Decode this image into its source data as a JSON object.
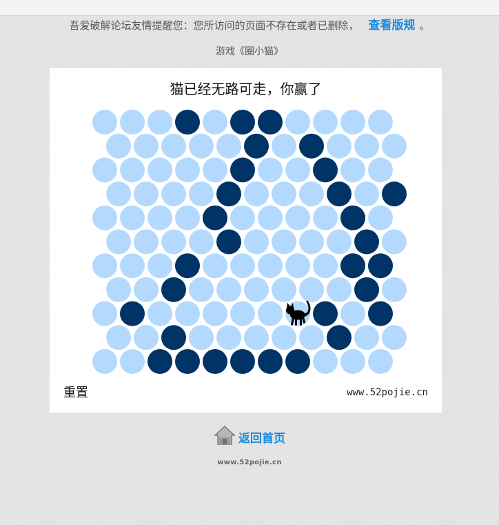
{
  "notice": {
    "text": "吾爱破解论坛友情提醒您：您所访问的页面不存在或者已删除，",
    "link_label": "查看版规",
    "suffix": "。"
  },
  "game": {
    "title": "游戏《圈小猫》",
    "status": "猫已经无路可走，你赢了",
    "reset_label": "重置",
    "watermark": "www.52pojie.cn",
    "grid_rows": [
      "00010110000",
      "00000101000",
      "00000100100",
      "00001000101",
      "00001000010",
      "00001000010",
      "00010000011",
      "00100000010",
      "01000000101",
      "00100000100",
      "00111111000"
    ],
    "cat": {
      "row": 8,
      "col": 7
    },
    "colors": {
      "wall": "#003366",
      "open": "#b3d9ff",
      "cat": "#000000"
    }
  },
  "home": {
    "label": "返回首页",
    "icon": "house-icon"
  },
  "footer": {
    "text": "www.52pojie.cn"
  }
}
